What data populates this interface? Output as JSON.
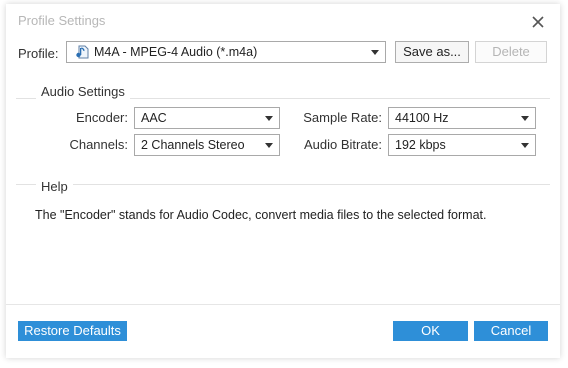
{
  "window": {
    "title": "Profile Settings"
  },
  "profile": {
    "label": "Profile:",
    "selected": "M4A - MPEG-4 Audio (*.m4a)",
    "icon": "audio-file-icon",
    "save_as_label": "Save as...",
    "delete_label": "Delete"
  },
  "audio_settings": {
    "header": "Audio Settings",
    "encoder_label": "Encoder:",
    "encoder_value": "AAC",
    "sample_rate_label": "Sample Rate:",
    "sample_rate_value": "44100 Hz",
    "channels_label": "Channels:",
    "channels_value": "2 Channels Stereo",
    "audio_bitrate_label": "Audio Bitrate:",
    "audio_bitrate_value": "192 kbps"
  },
  "help": {
    "header": "Help",
    "text": "The \"Encoder\" stands for Audio Codec, convert media files to the selected format."
  },
  "footer": {
    "restore_defaults_label": "Restore Defaults",
    "ok_label": "OK",
    "cancel_label": "Cancel"
  },
  "colors": {
    "accent": "#2e8fd8",
    "title_text": "#b7b7b7",
    "disabled_text": "#b5b5b5"
  }
}
